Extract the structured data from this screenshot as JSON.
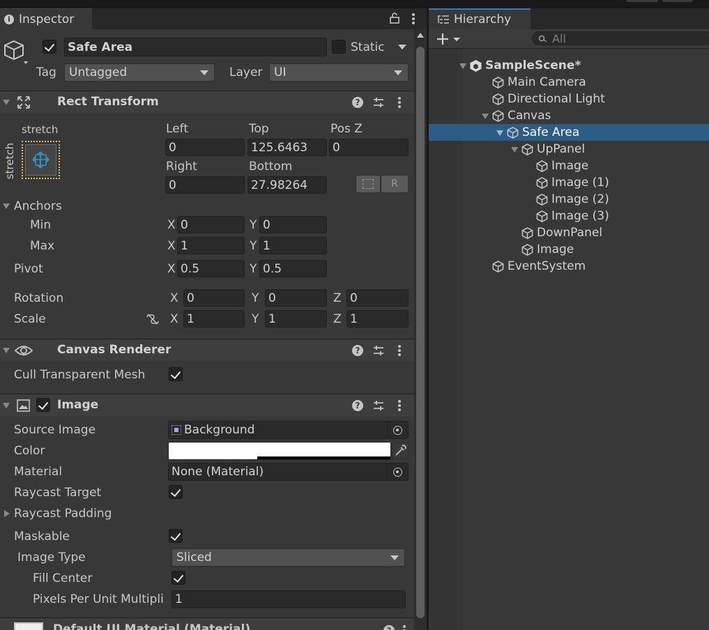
{
  "inspector": {
    "tab_label": "Inspector",
    "object": {
      "active": true,
      "name": "Safe Area",
      "static_label": "Static",
      "static_checked": false
    },
    "tag_label": "Tag",
    "tag_value": "Untagged",
    "layer_label": "Layer",
    "layer_value": "UI",
    "rect_transform": {
      "title": "Rect Transform",
      "anchor_preset_h": "stretch",
      "anchor_preset_v": "stretch",
      "left_label": "Left",
      "left": "0",
      "top_label": "Top",
      "top": "125.6463",
      "posz_label": "Pos Z",
      "posz": "0",
      "right_label": "Right",
      "right": "0",
      "bottom_label": "Bottom",
      "bottom": "27.98264",
      "r_button": "R",
      "anchors_label": "Anchors",
      "min_label": "Min",
      "min_x": "0",
      "min_y": "0",
      "max_label": "Max",
      "max_x": "1",
      "max_y": "1",
      "pivot_label": "Pivot",
      "pivot_x": "0.5",
      "pivot_y": "0.5",
      "rotation_label": "Rotation",
      "rot_x": "0",
      "rot_y": "0",
      "rot_z": "0",
      "scale_label": "Scale",
      "scale_x": "1",
      "scale_y": "1",
      "scale_z": "1",
      "axis_x": "X",
      "axis_y": "Y",
      "axis_z": "Z"
    },
    "canvas_renderer": {
      "title": "Canvas Renderer",
      "cull_label": "Cull Transparent Mesh",
      "cull": true
    },
    "image": {
      "title": "Image",
      "enabled": true,
      "source_label": "Source Image",
      "source": "Background",
      "color_label": "Color",
      "material_label": "Material",
      "material": "None (Material)",
      "raycast_label": "Raycast Target",
      "raycast": true,
      "raycast_padding_label": "Raycast Padding",
      "maskable_label": "Maskable",
      "maskable": true,
      "image_type_label": "Image Type",
      "image_type": "Sliced",
      "fill_center_label": "Fill Center",
      "fill_center": true,
      "ppu_label": "Pixels Per Unit Multipli",
      "ppu": "1"
    },
    "material_footer": "Default UI Material (Material)"
  },
  "hierarchy": {
    "tab_label": "Hierarchy",
    "search_placeholder": "All",
    "items": [
      {
        "label": "SampleScene*"
      },
      {
        "label": "Main Camera"
      },
      {
        "label": "Directional Light"
      },
      {
        "label": "Canvas"
      },
      {
        "label": "Safe Area"
      },
      {
        "label": "UpPanel"
      },
      {
        "label": "Image"
      },
      {
        "label": "Image (1)"
      },
      {
        "label": "Image (2)"
      },
      {
        "label": "Image (3)"
      },
      {
        "label": "DownPanel"
      },
      {
        "label": "Image"
      },
      {
        "label": "EventSystem"
      }
    ]
  },
  "colors": {
    "selection": "#2c5d87",
    "accent": "#3a79bb",
    "panel": "#383838"
  }
}
